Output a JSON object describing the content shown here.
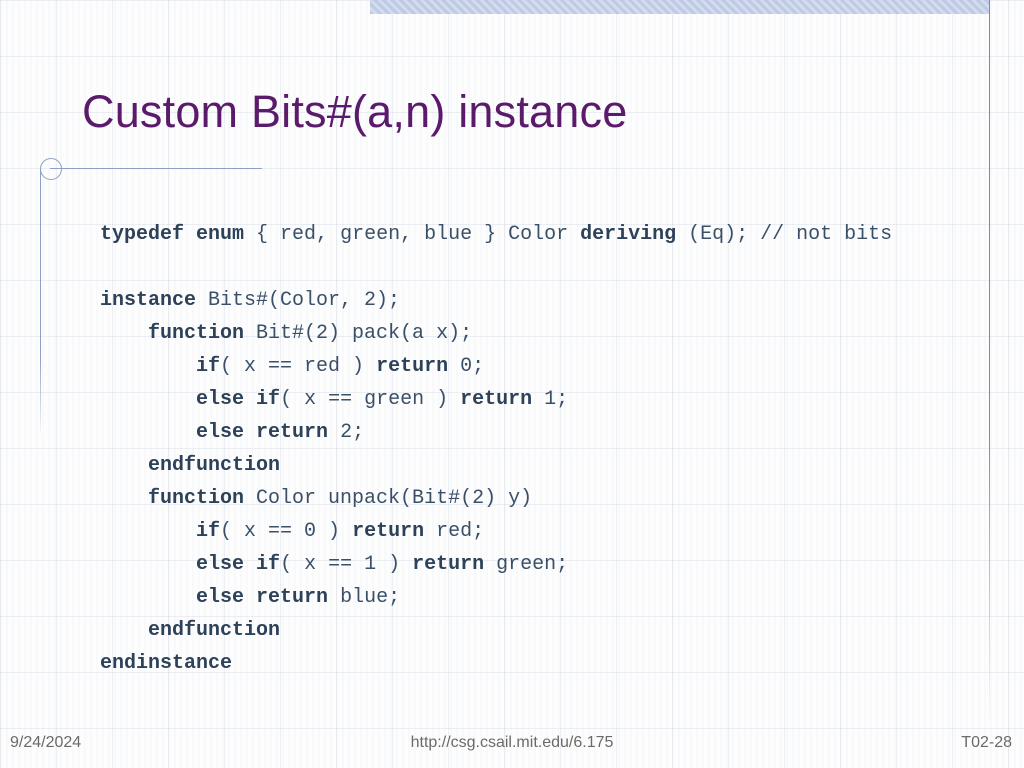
{
  "title": "Custom Bits#(a,n) instance",
  "code": {
    "line1": {
      "kw1": "typedef",
      "kw2": "enum",
      "t1": " { red, green, blue } Color ",
      "kw3": "deriving",
      "t2": " (Eq); // not bits"
    },
    "line2": {
      "kw1": "instance",
      "t1": " Bits#(Color, 2);"
    },
    "line3": {
      "kw1": "function",
      "t1": " Bit#(2) pack(a x);"
    },
    "line4": {
      "kw1": "if",
      "t1": "( x == red ) ",
      "kw2": "return",
      "t2": " 0;"
    },
    "line5": {
      "kw1": "else",
      "t1": " ",
      "kw2": "if",
      "t2": "( x == green ) ",
      "kw3": "return",
      "t3": " 1;"
    },
    "line6": {
      "kw1": "else",
      "t1": " ",
      "kw2": "return",
      "t2": " 2;"
    },
    "line7": {
      "kw1": "endfunction"
    },
    "line8": {
      "kw1": "function",
      "t1": " Color unpack(Bit#(2) y)"
    },
    "line9": {
      "kw1": "if",
      "t1": "( x == 0 ) ",
      "kw2": "return",
      "t2": " red;"
    },
    "line10": {
      "kw1": "else",
      "t1": " ",
      "kw2": "if",
      "t2": "( x == 1 ) ",
      "kw3": "return",
      "t3": " green;"
    },
    "line11": {
      "kw1": "else",
      "t1": " ",
      "kw2": "return",
      "t2": " blue;"
    },
    "line12": {
      "kw1": "endfunction"
    },
    "line13": {
      "kw1": "endinstance"
    }
  },
  "indent": {
    "i0": "",
    "i1": "    ",
    "i2": "        "
  },
  "footer": {
    "date": "9/24/2024",
    "url": "http://csg.csail.mit.edu/6.175",
    "page": "T02-28"
  }
}
